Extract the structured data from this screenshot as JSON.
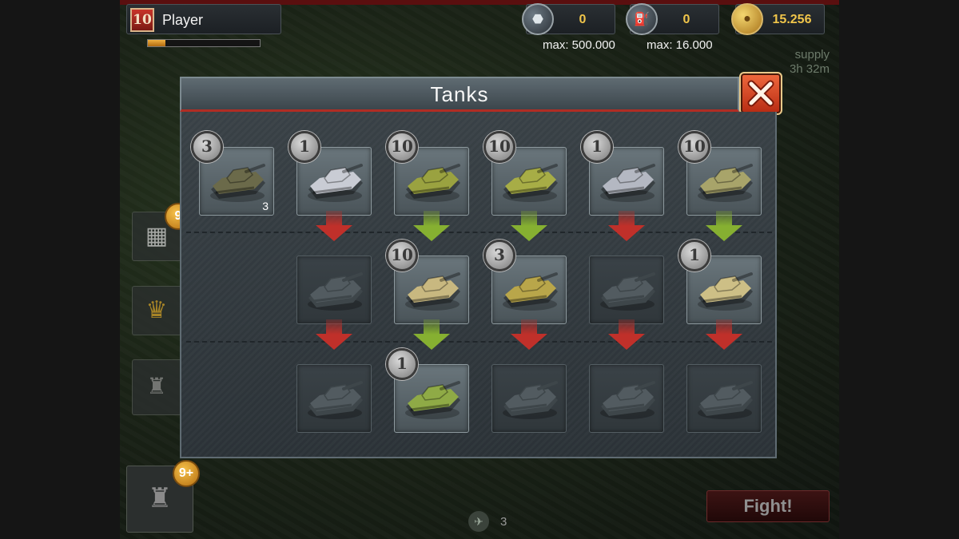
{
  "player": {
    "level": "10",
    "name": "Player",
    "xp_progress": 0.16
  },
  "resources": [
    {
      "icon": "steel-icon",
      "value": "0",
      "max": "max: 500.000"
    },
    {
      "icon": "fuel-canister-icon",
      "value": "0",
      "max": "max: 16.000"
    },
    {
      "icon": "gold-coin-icon",
      "value": "15.256"
    }
  ],
  "supply": {
    "label": "supply",
    "time": "3h 32m"
  },
  "dialog": {
    "title": "Tanks"
  },
  "tanks": {
    "row1": [
      {
        "count": "3",
        "owned": "3",
        "locked": false,
        "color": "#6b6a4a"
      },
      {
        "count": "1",
        "owned": "",
        "locked": false,
        "color": "#c9ccd4"
      },
      {
        "count": "10",
        "owned": "",
        "locked": false,
        "color": "#9aa240"
      },
      {
        "count": "10",
        "owned": "",
        "locked": false,
        "color": "#a7ad46"
      },
      {
        "count": "1",
        "owned": "",
        "locked": false,
        "color": "#b4b8c2"
      },
      {
        "count": "10",
        "owned": "",
        "locked": false,
        "color": "#a8a46a"
      }
    ],
    "row2": [
      {
        "count": "",
        "locked": true,
        "color": "#4c5459"
      },
      {
        "count": "10",
        "locked": false,
        "color": "#c8b880"
      },
      {
        "count": "3",
        "locked": false,
        "color": "#b9a64a"
      },
      {
        "count": "",
        "locked": true,
        "color": "#4c5459"
      },
      {
        "count": "1",
        "locked": false,
        "color": "#cdbf86"
      }
    ],
    "row3": [
      {
        "count": "",
        "locked": true,
        "color": "#4c5459"
      },
      {
        "count": "1",
        "locked": false,
        "color": "#8faa46"
      },
      {
        "count": "",
        "locked": true,
        "color": "#4c5459"
      },
      {
        "count": "",
        "locked": true,
        "color": "#4c5459"
      },
      {
        "count": "",
        "locked": true,
        "color": "#4c5459"
      }
    ]
  },
  "arrows": {
    "row1": [
      "red",
      "green",
      "green",
      "red",
      "green"
    ],
    "row2": [
      "red",
      "green",
      "red",
      "red",
      "red"
    ]
  },
  "background": {
    "badge_top": "9",
    "badge_bottom": "9+"
  },
  "fight": {
    "label": "Fight!"
  },
  "bottom": {
    "count": "3"
  },
  "colors": {
    "red_arrow": "#c0302a",
    "green_arrow": "#86b031",
    "accent": "#b02d24"
  }
}
